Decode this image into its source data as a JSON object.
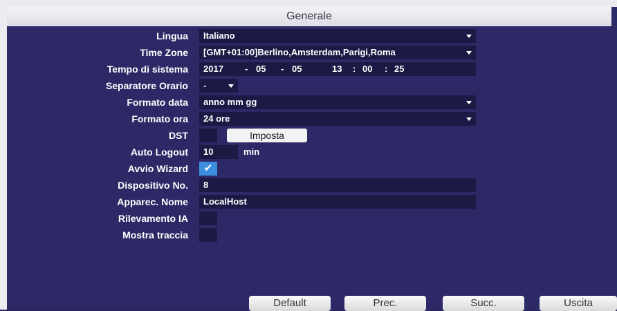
{
  "window": {
    "title": "Generale"
  },
  "fields": {
    "lingua": {
      "label": "Lingua",
      "value": "Italiano"
    },
    "time_zone": {
      "label": "Time Zone",
      "value": "[GMT+01:00]Berlino,Amsterdam,Parigi,Roma"
    },
    "tempo": {
      "label": "Tempo di sistema",
      "year": "2017",
      "month": "05",
      "day": "05",
      "hour": "13",
      "minute": "00",
      "second": "25",
      "date_sep": "-",
      "time_sep": ":"
    },
    "separatore": {
      "label": "Separatore Orario",
      "value": "-"
    },
    "formato_data": {
      "label": "Formato data",
      "value": "anno mm gg"
    },
    "formato_ora": {
      "label": "Formato ora",
      "value": "24 ore"
    },
    "dst": {
      "label": "DST",
      "button": "Imposta"
    },
    "auto_logout": {
      "label": "Auto Logout",
      "value": "10",
      "unit": "min"
    },
    "avvio_wizard": {
      "label": "Avvio Wizard",
      "checked": true
    },
    "dispositivo": {
      "label": "Dispositivo No.",
      "value": "8"
    },
    "apparec_nome": {
      "label": "Apparec. Nome",
      "value": "LocalHost"
    },
    "rilevamento": {
      "label": "Rilevamento IA",
      "checked": false
    },
    "mostra_traccia": {
      "label": "Mostra traccia",
      "checked": false
    }
  },
  "footer": {
    "default": "Default",
    "prec": "Prec.",
    "succ": "Succ.",
    "uscita": "Uscita"
  },
  "colors": {
    "background": "#2c2966",
    "field": "#1c1a45",
    "checkbox_on": "#3d8ee0"
  }
}
